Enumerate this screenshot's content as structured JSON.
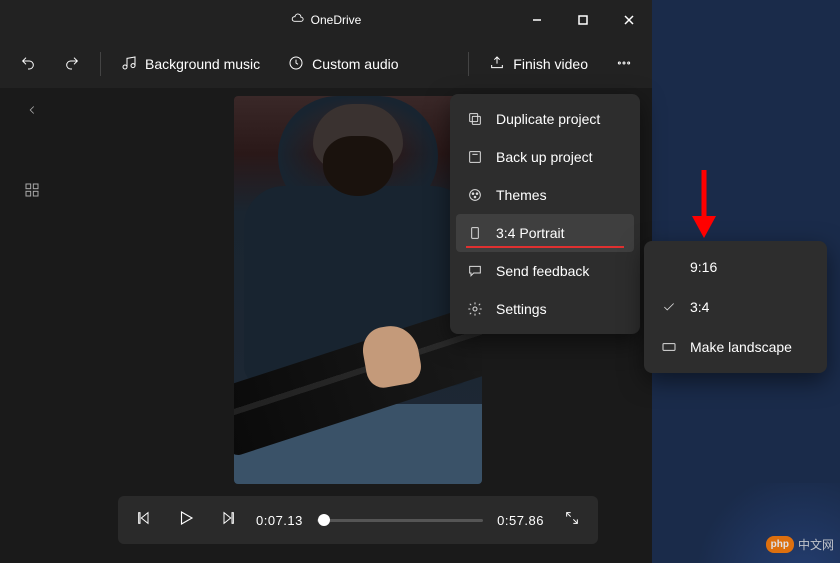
{
  "window": {
    "title": "OneDrive"
  },
  "toolbar": {
    "background_music": "Background music",
    "custom_audio": "Custom audio",
    "finish_video": "Finish video"
  },
  "player": {
    "current_time": "0:07.13",
    "total_time": "0:57.86",
    "progress_pct": 4
  },
  "more_menu": {
    "duplicate": "Duplicate project",
    "backup": "Back up project",
    "themes": "Themes",
    "aspect": "3:4 Portrait",
    "feedback": "Send feedback",
    "settings": "Settings"
  },
  "aspect_menu": {
    "opt_916": "9:16",
    "opt_34": "3:4",
    "opt_landscape": "Make landscape",
    "selected": "3:4"
  },
  "watermark": {
    "badge": "php",
    "text": "中文网"
  }
}
